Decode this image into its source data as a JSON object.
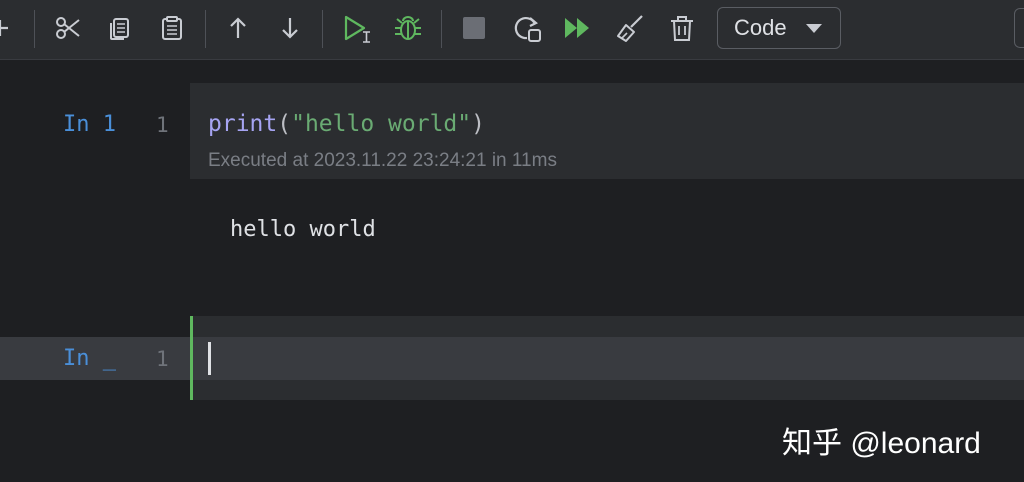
{
  "toolbar": {
    "icons": [
      "add-cell-icon",
      "cut-icon",
      "copy-icon",
      "paste-icon",
      "move-up-icon",
      "move-down-icon",
      "run-cell-icon",
      "debug-icon",
      "stop-icon",
      "restart-icon",
      "run-all-icon",
      "clear-outputs-icon",
      "delete-icon"
    ],
    "cell_type": "Code",
    "colors": {
      "run": "#5fb85f",
      "icon": "#c9ccd2"
    }
  },
  "cells": [
    {
      "prompt": "In 1",
      "line_number": "1",
      "code": {
        "fn": "print",
        "open": "(",
        "string": "\"hello world\"",
        "close": ")"
      },
      "status": "Executed at 2023.11.22 23:24:21 in 11ms",
      "output": "hello world"
    },
    {
      "prompt": "In _",
      "line_number": "1",
      "code": ""
    }
  ],
  "watermark": "知乎 @leonard"
}
